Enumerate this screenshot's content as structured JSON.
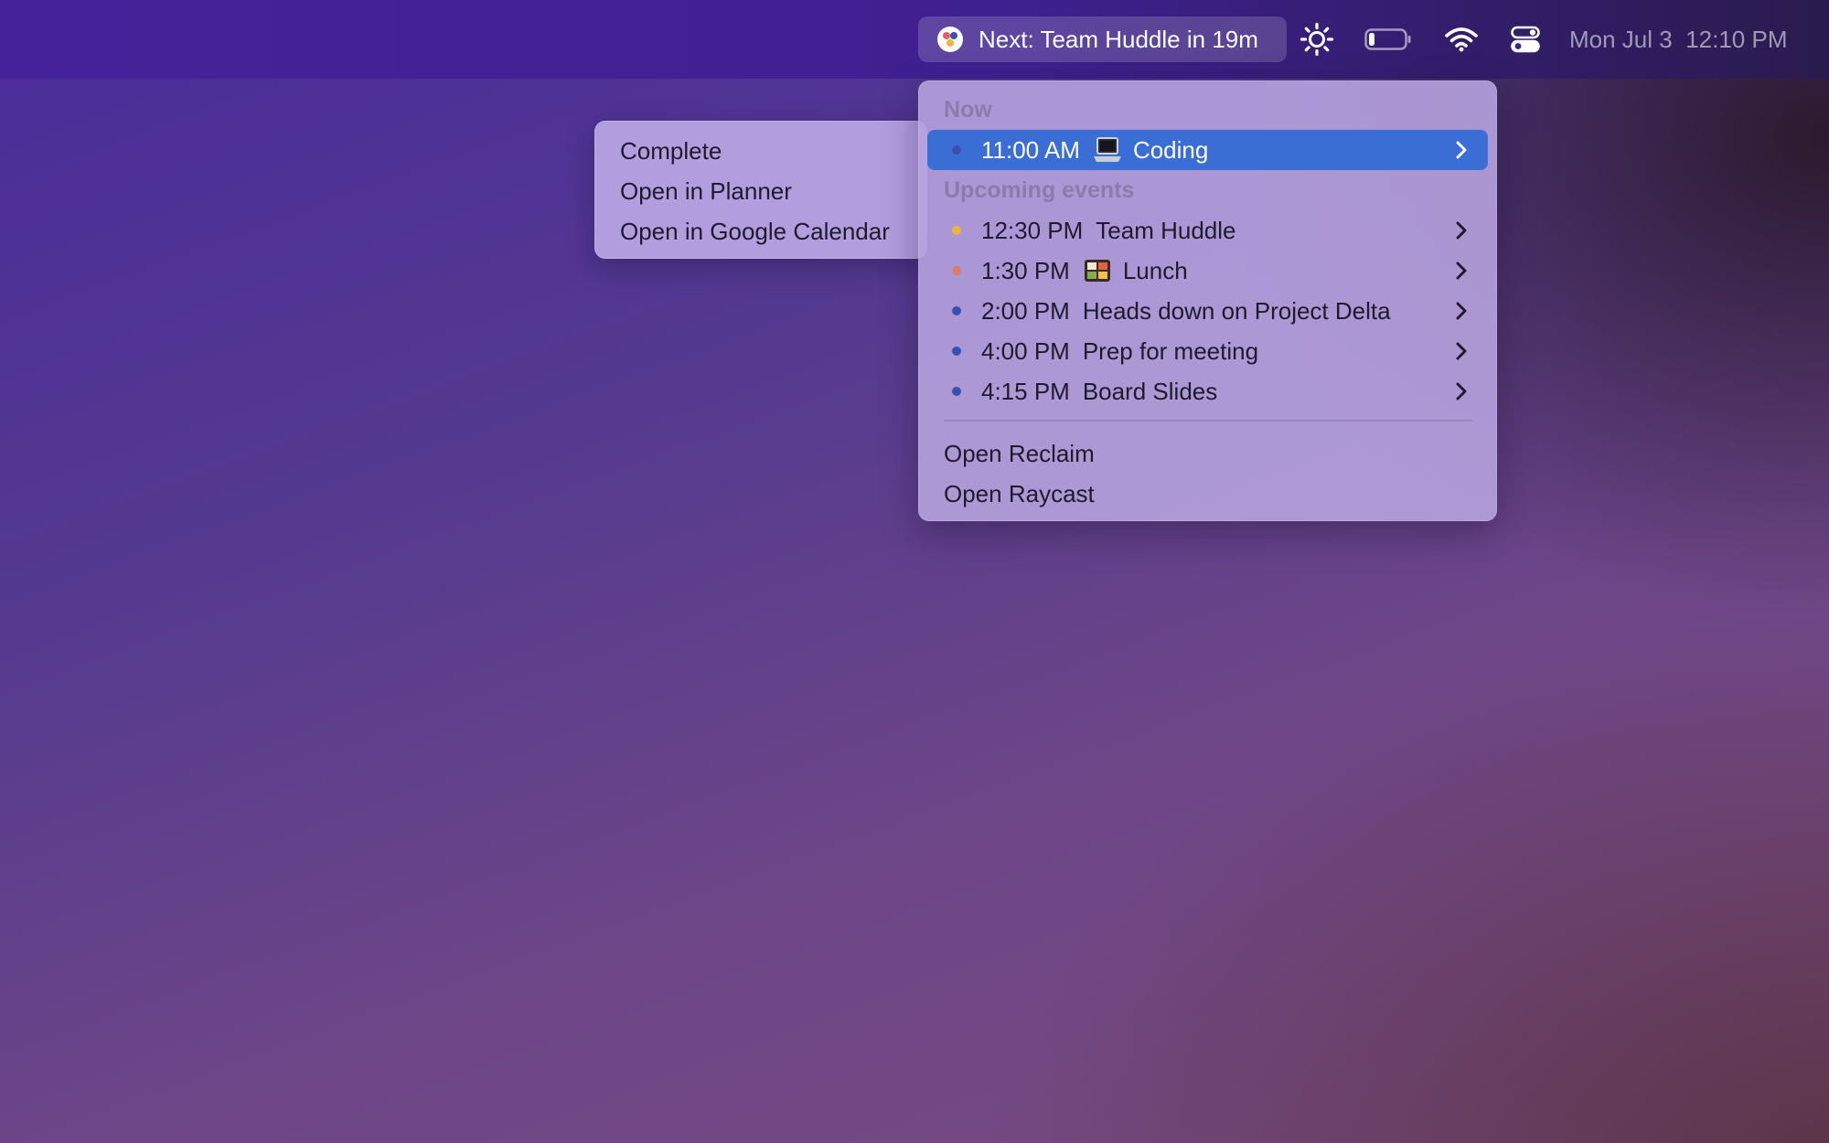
{
  "menubar": {
    "reclaim_status": "Next: Team Huddle in 19m",
    "date": "Mon Jul 3",
    "time": "12:10 PM",
    "icons": [
      "reclaim-logo-icon",
      "sun-brightness-icon",
      "battery-icon",
      "wifi-icon",
      "control-center-icon"
    ]
  },
  "menu": {
    "now_header": "Now",
    "now_item": {
      "time": "11:00 AM",
      "emoji": "laptop",
      "title": "Coding",
      "dot_color": "#3a4fb0"
    },
    "upcoming_header": "Upcoming events",
    "upcoming": [
      {
        "time": "12:30 PM",
        "emoji": "",
        "title": "Team Huddle",
        "dot_color": "#f0b43a"
      },
      {
        "time": "1:30 PM",
        "emoji": "bento-box",
        "title": "Lunch",
        "dot_color": "#e07a6a"
      },
      {
        "time": "2:00 PM",
        "emoji": "",
        "title": "Heads down on Project Delta",
        "dot_color": "#3a4fb0"
      },
      {
        "time": "4:00 PM",
        "emoji": "",
        "title": "Prep for meeting",
        "dot_color": "#3a4fb0"
      },
      {
        "time": "4:15 PM",
        "emoji": "",
        "title": "Board Slides",
        "dot_color": "#3a4fb0"
      }
    ],
    "footer": [
      "Open Reclaim",
      "Open Raycast"
    ]
  },
  "submenu": {
    "items": [
      "Complete",
      "Open in Planner",
      "Open in Google Calendar"
    ]
  },
  "colors": {
    "selection": "#3a6ed4",
    "menu_bg": "#b6a2de"
  }
}
